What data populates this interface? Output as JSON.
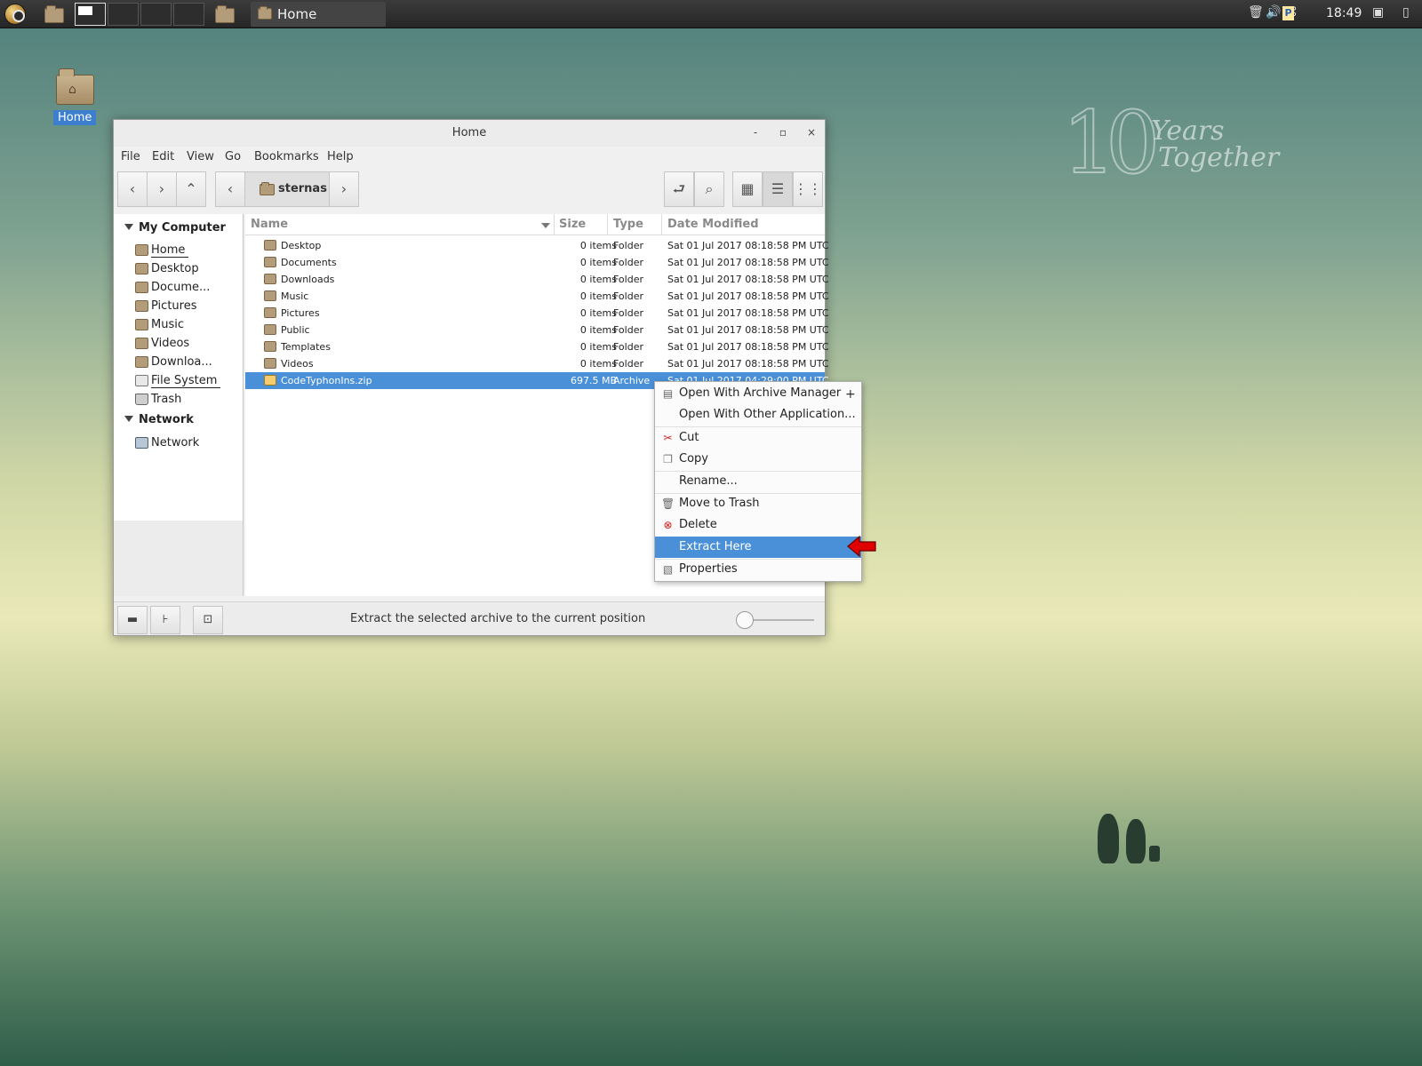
{
  "panel": {
    "task_label": "Home",
    "clock": "18:49",
    "tray_p": "P"
  },
  "desktop": {
    "home_icon_label": "Home",
    "logo_number": "10",
    "logo_line1": "Years",
    "logo_line2": "Together"
  },
  "window": {
    "title": "Home",
    "minimize": "-",
    "maximize": "▫",
    "close": "×"
  },
  "menubar": {
    "items": [
      "File",
      "Edit",
      "View",
      "Go",
      "Bookmarks",
      "Help"
    ]
  },
  "toolbar": {
    "back": "‹",
    "forward": "›",
    "up": "⌃",
    "crumb_prev": "‹",
    "crumb_label": "sternas",
    "crumb_next": "›",
    "toggle_location": "⮐",
    "search": "⌕",
    "view_icons": "▦",
    "view_list": "☰",
    "view_compact": "⋮⋮"
  },
  "sidebar": {
    "sections": [
      {
        "title": "My Computer"
      },
      {
        "title": "Network"
      }
    ],
    "items": [
      {
        "label": "Home",
        "icon": "home-folder-icon"
      },
      {
        "label": "Desktop",
        "icon": "folder-icon"
      },
      {
        "label": "Docume...",
        "icon": "folder-icon"
      },
      {
        "label": "Pictures",
        "icon": "folder-icon"
      },
      {
        "label": "Music",
        "icon": "folder-icon"
      },
      {
        "label": "Videos",
        "icon": "folder-icon"
      },
      {
        "label": "Downloa...",
        "icon": "folder-icon"
      },
      {
        "label": "File System",
        "icon": "drive-icon"
      },
      {
        "label": "Trash",
        "icon": "trash-icon"
      },
      {
        "label": "Network",
        "icon": "network-icon"
      }
    ]
  },
  "list": {
    "columns": [
      "Name",
      "Size",
      "Type",
      "Date Modified"
    ],
    "rows": [
      {
        "name": "Desktop",
        "size": "0 items",
        "type": "Folder",
        "date": "Sat 01 Jul 2017 08:18:58 PM UTC"
      },
      {
        "name": "Documents",
        "size": "0 items",
        "type": "Folder",
        "date": "Sat 01 Jul 2017 08:18:58 PM UTC"
      },
      {
        "name": "Downloads",
        "size": "0 items",
        "type": "Folder",
        "date": "Sat 01 Jul 2017 08:18:58 PM UTC"
      },
      {
        "name": "Music",
        "size": "0 items",
        "type": "Folder",
        "date": "Sat 01 Jul 2017 08:18:58 PM UTC"
      },
      {
        "name": "Pictures",
        "size": "0 items",
        "type": "Folder",
        "date": "Sat 01 Jul 2017 08:18:58 PM UTC"
      },
      {
        "name": "Public",
        "size": "0 items",
        "type": "Folder",
        "date": "Sat 01 Jul 2017 08:18:58 PM UTC"
      },
      {
        "name": "Templates",
        "size": "0 items",
        "type": "Folder",
        "date": "Sat 01 Jul 2017 08:18:58 PM UTC"
      },
      {
        "name": "Videos",
        "size": "0 items",
        "type": "Folder",
        "date": "Sat 01 Jul 2017 08:18:58 PM UTC"
      },
      {
        "name": "CodeTyphonIns.zip",
        "size": "697.5 MB",
        "type": "Archive",
        "date": "Sat 01 Jul 2017 04:29:00 PM UTC"
      }
    ]
  },
  "context_menu": {
    "items": [
      {
        "label": "Open With Archive Manager",
        "icon": "archive-manager-icon",
        "submenu": "+"
      },
      {
        "label": "Open With Other Application..."
      },
      {
        "label": "Cut",
        "icon": "scissors-icon"
      },
      {
        "label": "Copy",
        "icon": "copy-icon"
      },
      {
        "label": "Rename..."
      },
      {
        "label": "Move to Trash",
        "icon": "trash-icon"
      },
      {
        "label": "Delete",
        "icon": "delete-icon"
      },
      {
        "label": "Extract Here",
        "highlighted": true
      },
      {
        "label": "Properties",
        "icon": "properties-icon"
      }
    ]
  },
  "statusbar": {
    "text": "Extract the selected archive to the current position",
    "zoom_level": 0
  },
  "colors": {
    "selection": "#4a90d9",
    "annotation_arrow": "#e00000"
  }
}
